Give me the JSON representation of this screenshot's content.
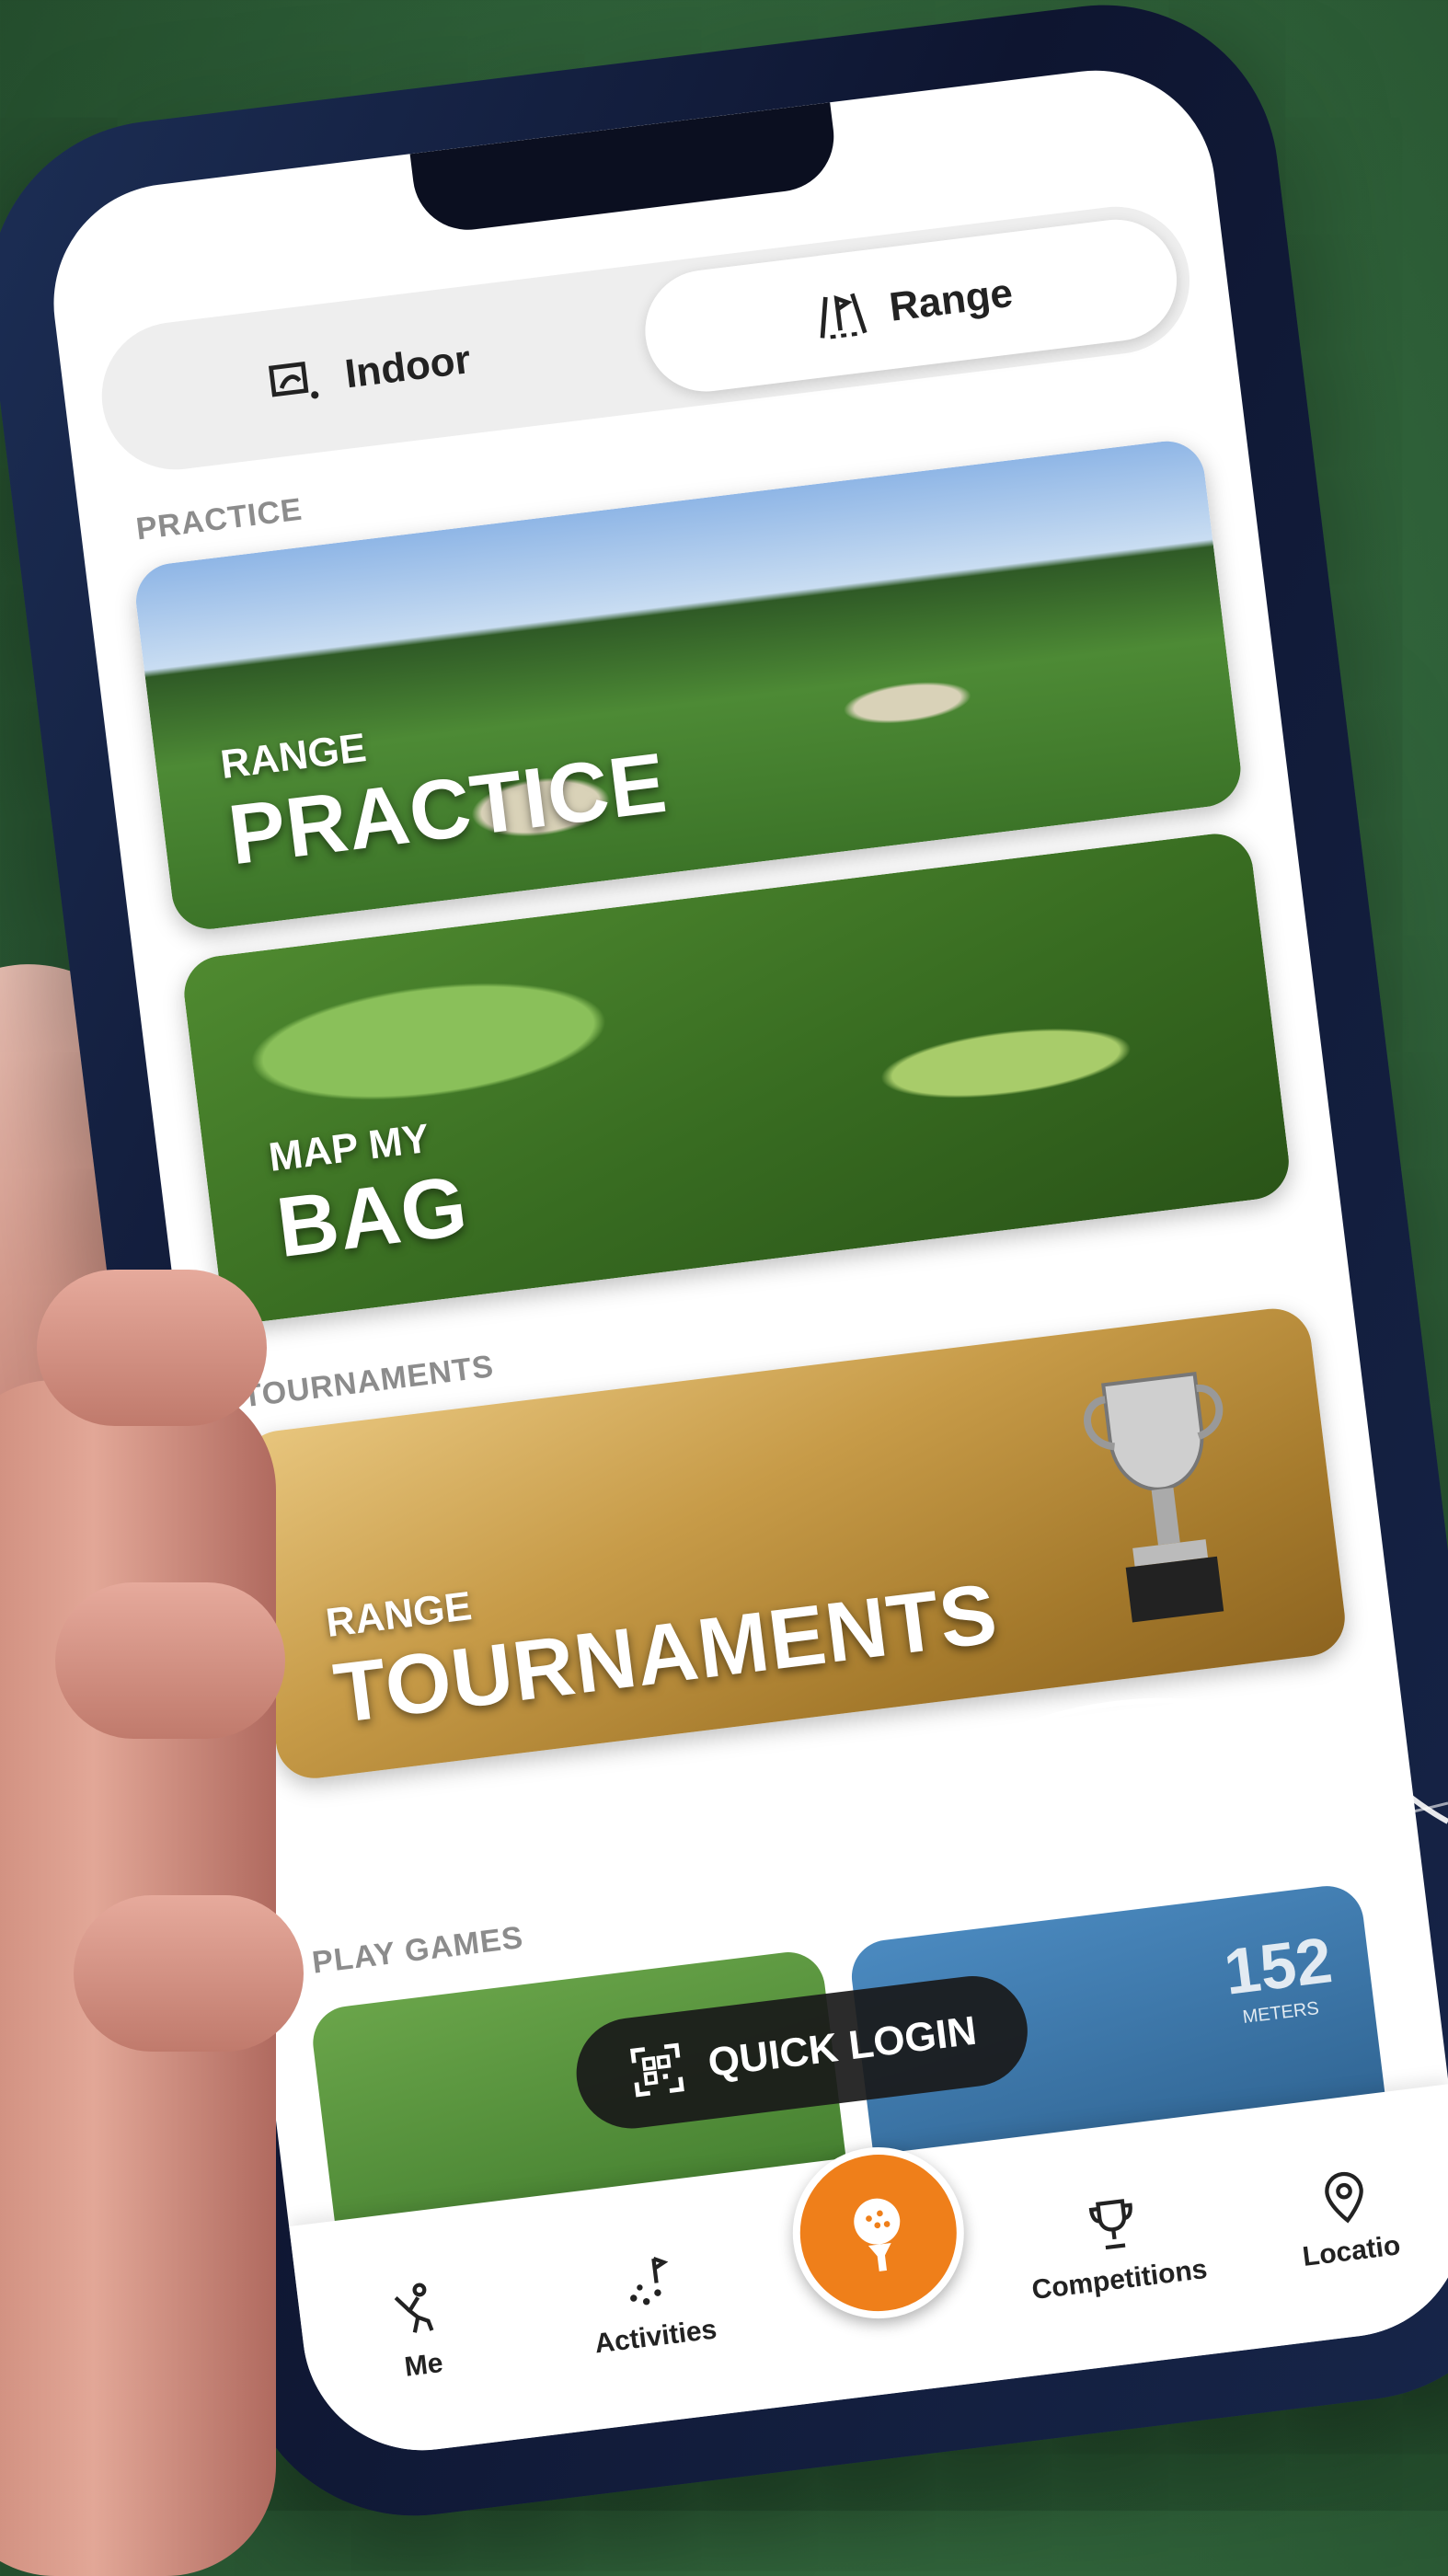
{
  "mode_switch": {
    "indoor_label": "Indoor",
    "range_label": "Range",
    "active": "Range"
  },
  "sections": {
    "practice": "PRACTICE",
    "tournaments": "TOURNAMENTS",
    "play_games": "PLAY GAMES"
  },
  "cards": {
    "range_practice": {
      "subtitle": "RANGE",
      "title": "PRACTICE"
    },
    "map_my_bag": {
      "subtitle": "MAP MY",
      "title": "BAG"
    },
    "range_tournaments": {
      "subtitle": "RANGE",
      "title": "TOURNAMENTS"
    }
  },
  "game_distance": "152",
  "game_distance_unit": "METERS",
  "quick_login": {
    "label": "QUICK LOGIN",
    "icon": "qr-code-icon"
  },
  "tabbar": {
    "me": "Me",
    "activities": "Activities",
    "competitions": "Competitions",
    "location": "Locatio",
    "center_icon": "golf-ball-tee-icon"
  },
  "colors": {
    "accent_orange": "#ef7f1a",
    "tab_background": "#ffffff",
    "gold_card": "#c79b48"
  }
}
